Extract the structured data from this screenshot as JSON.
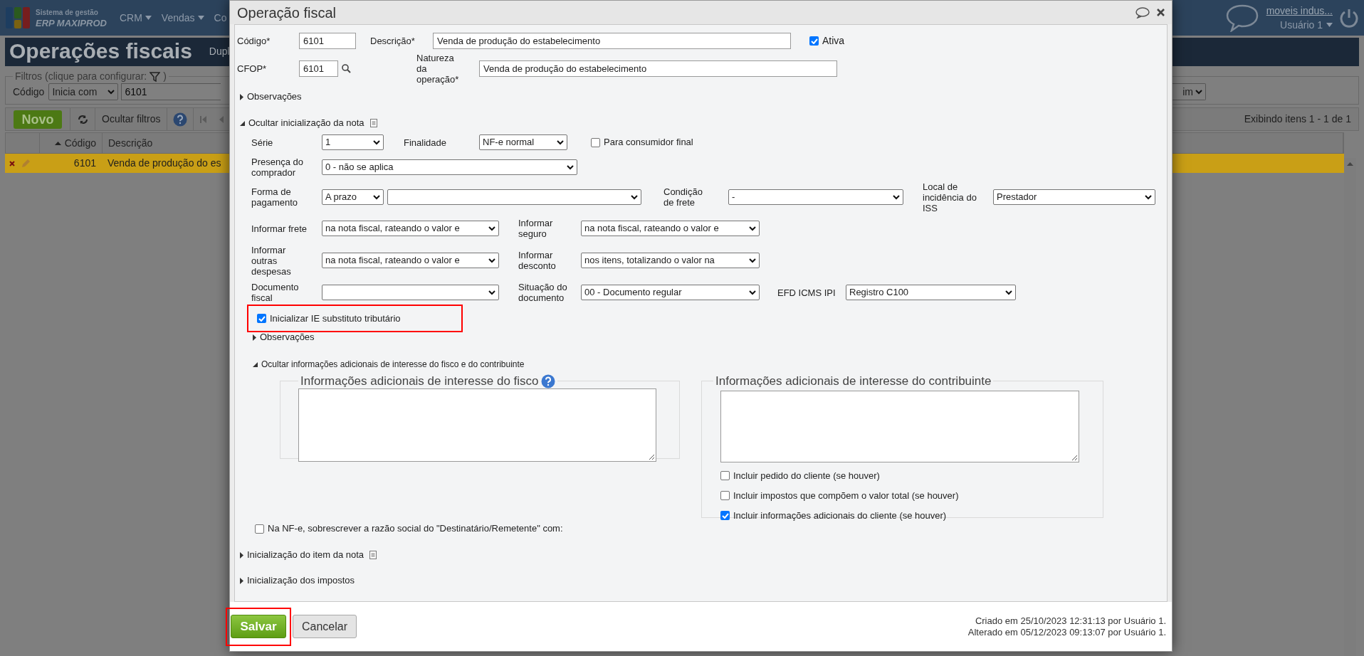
{
  "app": {
    "logo_line1": "Sistema de gestão",
    "logo_line2": "ERP MAXIPROD",
    "menu": [
      {
        "label": "CRM"
      },
      {
        "label": "Vendas"
      },
      {
        "label": "Co"
      }
    ],
    "company": "moveis indus...",
    "user": "Usuário 1"
  },
  "page": {
    "title": "Operações fiscais",
    "title_action": "Dupl",
    "filters": {
      "legend": "Filtros (clique para configurar:",
      "legend_end": ")",
      "field_label": "Código",
      "operator": "Inicia com",
      "value": "6101",
      "right_select": "im"
    },
    "toolbar": {
      "new_button": "Novo",
      "hide_filters": "Ocultar filtros",
      "paging": "Exibindo itens 1 - 1 de 1"
    },
    "table": {
      "columns": [
        {
          "label": "Código",
          "sorted": true
        },
        {
          "label": "Descrição",
          "sorted": false
        }
      ],
      "rows": [
        {
          "codigo": "6101",
          "descricao": "Venda de produção do es",
          "selected": true
        }
      ]
    }
  },
  "dialog": {
    "title": "Operação fiscal",
    "codigo": {
      "label": "Código*",
      "value": "6101"
    },
    "descricao": {
      "label": "Descrição*",
      "value": "Venda de produção do estabelecimento"
    },
    "ativa": {
      "label": "Ativa",
      "checked": true
    },
    "cfop": {
      "label": "CFOP*",
      "value": "6101"
    },
    "natureza": {
      "label": "Natureza da operação*",
      "value": "Venda de produção do estabelecimento"
    },
    "observacoes": {
      "label": "Observações",
      "expanded": false
    },
    "nota_section": {
      "label": "Ocultar inicialização da nota",
      "expanded": true,
      "rows": [
        [
          {
            "kind": "select",
            "label": "Série",
            "value": "1"
          },
          {
            "kind": "select",
            "label": "Finalidade",
            "value": "NF-e normal"
          }
        ],
        [
          {
            "kind": "select",
            "label": "Presença do comprador",
            "value": "0 - não se aplica"
          }
        ],
        [
          {
            "kind": "select_pair",
            "label": "Forma de pagamento",
            "value": "A prazo"
          },
          {
            "kind": "select",
            "label": "Condição de frete",
            "value": "-"
          },
          {
            "kind": "select",
            "label": "Local de incidência do ISS",
            "value": "Prestador"
          }
        ],
        [
          {
            "kind": "select",
            "label": "Informar frete",
            "value": "na nota fiscal, rateando o valor e"
          },
          {
            "kind": "select",
            "label": "Informar seguro",
            "value": "na nota fiscal, rateando o valor e"
          }
        ],
        [
          {
            "kind": "select",
            "label": "Informar outras despesas",
            "value": "na nota fiscal, rateando o valor e"
          },
          {
            "kind": "select",
            "label": "Informar desconto",
            "value": "nos itens, totalizando o valor na"
          }
        ],
        [
          {
            "kind": "select",
            "label": "Documento fiscal"
          },
          {
            "kind": "select",
            "label": "Situação do documento",
            "value": "00 - Documento regular"
          },
          {
            "kind": "select",
            "label": "EFD ICMS IPI",
            "value": "Registro C100"
          }
        ]
      ],
      "consumidor_final": {
        "label": "Para consumidor final",
        "checked": false
      },
      "ie_substituto": {
        "label": "Inicializar IE substituto tributário",
        "checked": true,
        "highlighted": true
      },
      "observacoes": {
        "label": "Observações",
        "expanded": false
      }
    },
    "adicionais_section": {
      "label": "Ocultar informações adicionais de interesse do fisco e do contribuinte",
      "expanded": true,
      "fisco": {
        "legend": "Informações adicionais de interesse do fisco"
      },
      "contribuinte": {
        "legend": "Informações adicionais de interesse do contribuinte",
        "options": [
          {
            "label": "Incluir pedido do cliente (se houver)",
            "checked": false
          },
          {
            "label": "Incluir impostos que compõem o valor total (se houver)",
            "checked": false
          },
          {
            "label": "Incluir informações adicionais do cliente (se houver)",
            "checked": true
          }
        ]
      }
    },
    "razao_social": {
      "label": "Na NF-e, sobrescrever a razão social do \"Destinatário/Remetente\" com:",
      "checked": false
    },
    "item_section": {
      "label": "Inicialização do item da nota",
      "expanded": false
    },
    "impostos_section": {
      "label": "Inicialização dos impostos",
      "expanded": false
    },
    "footer": {
      "save": {
        "label": "Salvar",
        "highlighted": true
      },
      "cancel": "Cancelar",
      "created": "Criado em 25/10/2023 12:31:13 por Usuário 1.",
      "altered": "Alterado em 05/12/2023 09:13:07 por Usuário 1."
    }
  }
}
